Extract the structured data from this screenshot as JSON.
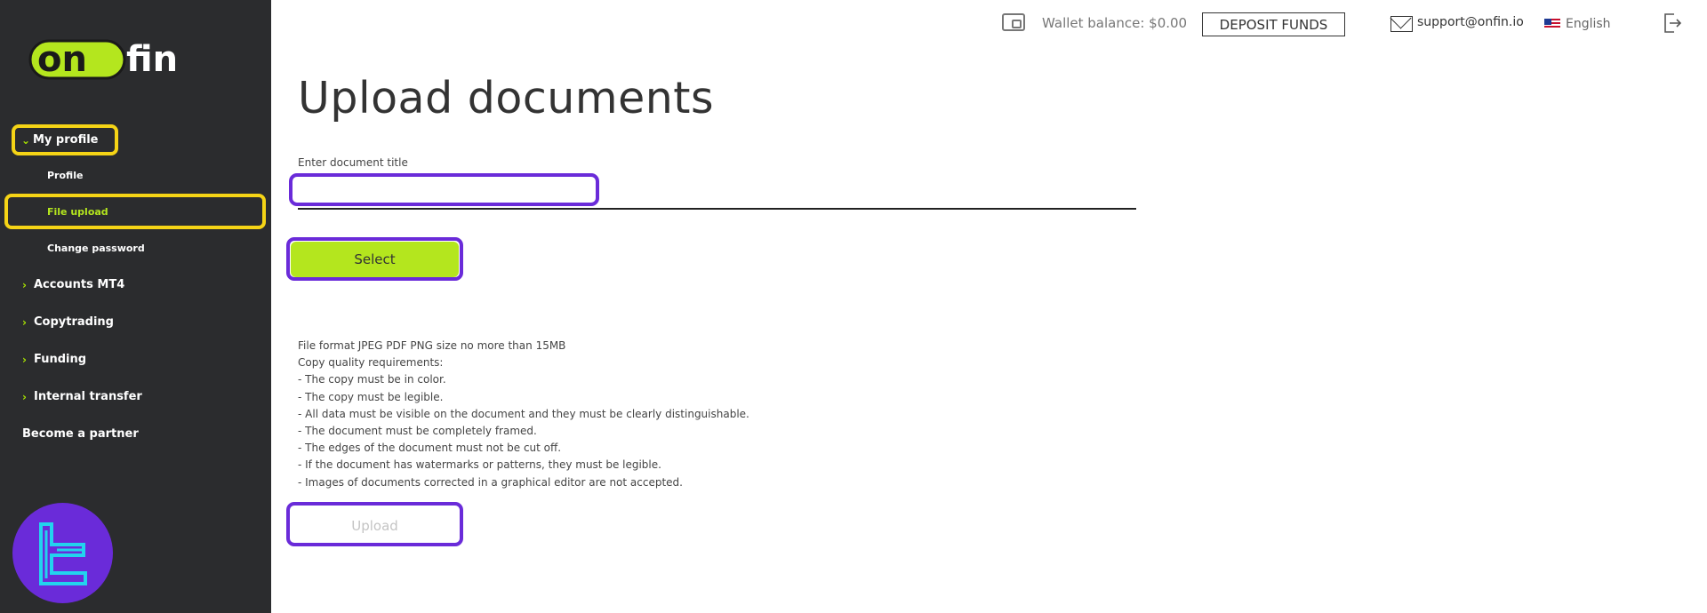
{
  "brand": {
    "name": "onfin",
    "accent": "#b4e61e",
    "sidebar_bg": "#2b2c2e",
    "highlight_yellow": "#f5d416",
    "highlight_purple": "#6a2bd9"
  },
  "header": {
    "wallet_label": "Wallet balance: $0.00",
    "deposit_label": "DEPOSIT FUNDS",
    "support_email": "support@onfin.io",
    "language": "English",
    "icons": [
      "wallet-icon",
      "mail-icon",
      "us-flag-icon",
      "logout-icon"
    ]
  },
  "sidebar": {
    "my_profile": "My profile",
    "sub_items": [
      "Profile",
      "File upload",
      "Change password"
    ],
    "active_sub": "File upload",
    "sections": [
      "Accounts MT4",
      "Copytrading",
      "Funding",
      "Internal transfer"
    ],
    "partner": "Become a partner"
  },
  "main": {
    "title": "Upload documents",
    "field_label": "Enter document title",
    "field_value": "",
    "select_label": "Select",
    "upload_label": "Upload",
    "requirements": [
      "File format JPEG PDF PNG size no more than 15MB",
      "Copy quality requirements:",
      "- The copy must be in color.",
      "- The copy must be legible.",
      "- All data must be visible on the document and they must be clearly distinguishable.",
      "- The document must be completely framed.",
      "- The edges of the document must not be cut off.",
      "- If the document has watermarks or patterns, they must be legible.",
      "- Images of documents corrected in a graphical editor are not accepted."
    ]
  }
}
